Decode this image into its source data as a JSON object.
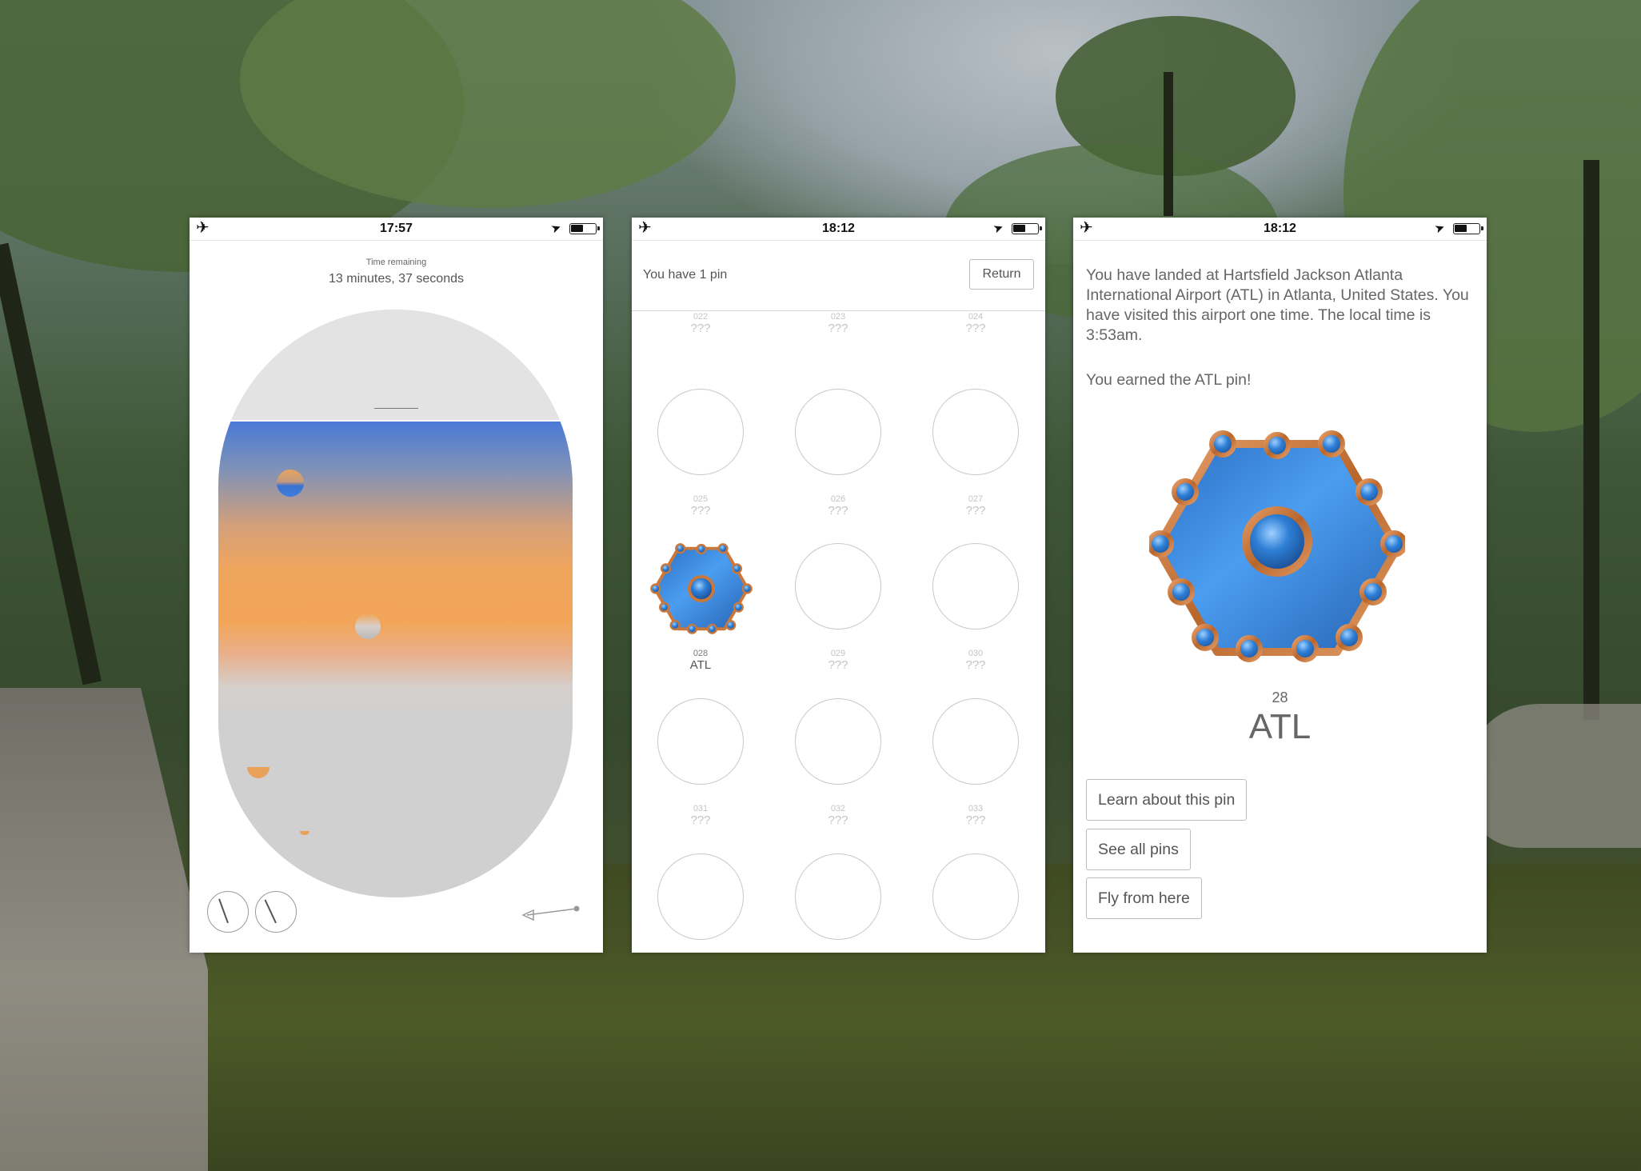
{
  "colors": {
    "pin_blue": "#3b86d8",
    "pin_rim": "#c9773a",
    "window_blue": "#4a79d6",
    "window_orange": "#f2a558",
    "frame_gray": "#d2d2d2"
  },
  "phone1": {
    "status": {
      "time": "17:57",
      "plane_icon": "airplane-icon",
      "location_icon": "location-arrow-icon",
      "battery_icon": "battery-icon"
    },
    "timer_label": "Time remaining",
    "timer_value": "13 minutes, 37 seconds"
  },
  "phone2": {
    "status": {
      "time": "18:12"
    },
    "pin_count": "You have 1 pin",
    "return_label": "Return",
    "slots": [
      {
        "num": "022",
        "name": "???"
      },
      {
        "num": "023",
        "name": "???"
      },
      {
        "num": "024",
        "name": "???"
      },
      {
        "num": "025",
        "name": "???"
      },
      {
        "num": "026",
        "name": "???"
      },
      {
        "num": "027",
        "name": "???"
      },
      {
        "num": "028",
        "name": "ATL",
        "earned": true
      },
      {
        "num": "029",
        "name": "???"
      },
      {
        "num": "030",
        "name": "???"
      },
      {
        "num": "031",
        "name": "???"
      },
      {
        "num": "032",
        "name": "???"
      },
      {
        "num": "033",
        "name": "???"
      },
      {
        "num": "",
        "name": ""
      },
      {
        "num": "",
        "name": ""
      },
      {
        "num": "",
        "name": ""
      }
    ]
  },
  "phone3": {
    "status": {
      "time": "18:12"
    },
    "message": "You have landed at Hartsfield Jackson Atlanta International Airport (ATL) in Atlanta, United States. You have visited this airport one time. The local time is 3:53am.",
    "earned": "You earned the ATL pin!",
    "pin_number": "28",
    "pin_name": "ATL",
    "buttons": {
      "learn": "Learn about this pin",
      "see_all": "See all pins",
      "fly": "Fly from here"
    }
  }
}
